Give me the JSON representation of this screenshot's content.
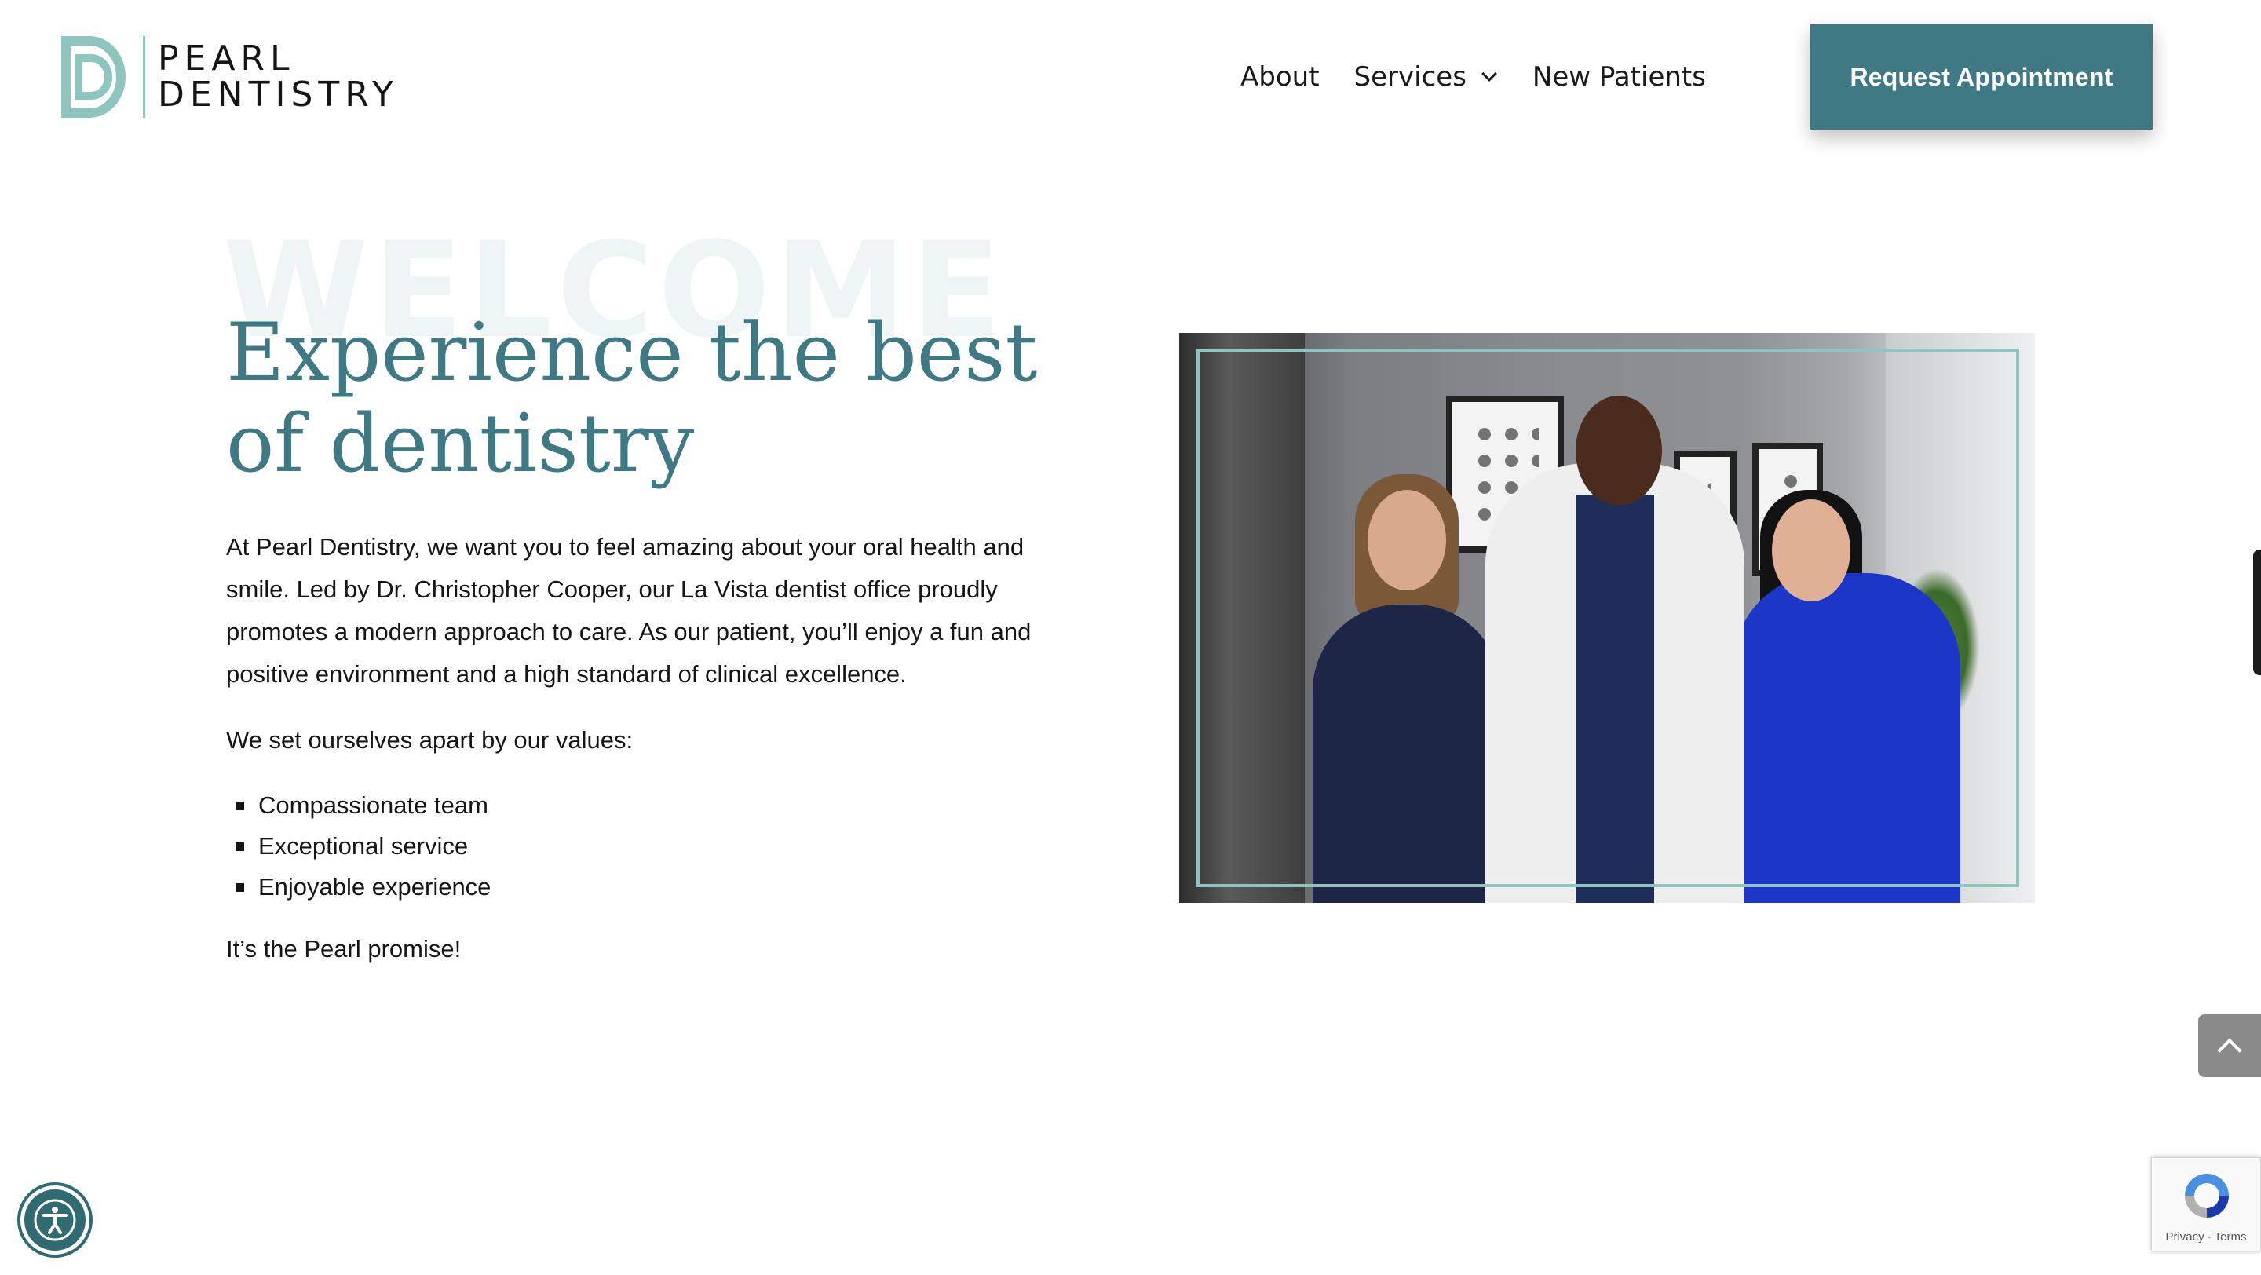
{
  "header": {
    "logo_line1": "PEARL",
    "logo_line2": "DENTISTRY",
    "nav": {
      "about": "About",
      "services": "Services",
      "new_patients": "New Patients"
    },
    "cta_label": "Request Appointment"
  },
  "hero": {
    "watermark": "WELCOME",
    "headline": "Experience the best of dentistry",
    "intro": "At Pearl Dentistry, we want you to feel amazing about your oral health and smile. Led by Dr. Christopher Cooper, our La Vista dentist office proudly promotes a modern approach to care. As our patient, you’ll enjoy a fun and positive environment and a high standard of clinical excellence.",
    "values_intro": "We set ourselves apart by our values:",
    "values": [
      "Compassionate team",
      "Exceptional service",
      "Enjoyable experience"
    ],
    "closing": "It’s the Pearl promise!"
  },
  "widgets": {
    "recaptcha_links": "Privacy - Terms"
  },
  "colors": {
    "brand_teal": "#3f7a84",
    "accent_mint": "#8ec6bf",
    "watermark": "#eef5f4"
  },
  "icons": {
    "chevron": "chevron-down-icon",
    "back_to_top": "chevron-up-icon",
    "accessibility": "accessibility-icon",
    "recaptcha": "recaptcha-icon"
  }
}
